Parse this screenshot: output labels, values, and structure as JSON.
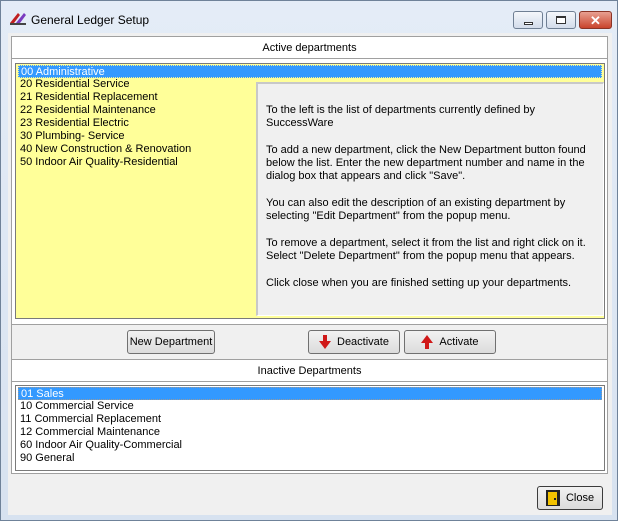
{
  "window": {
    "title": "General Ledger Setup",
    "controls": {
      "minimize": "minimize",
      "maximize": "maximize",
      "close": "✕"
    }
  },
  "active_section": {
    "header": "Active departments",
    "items": [
      {
        "label": "00 Administrative",
        "selected": true
      },
      {
        "label": "20 Residential Service",
        "selected": false
      },
      {
        "label": "21 Residential Replacement",
        "selected": false
      },
      {
        "label": "22 Residential Maintenance",
        "selected": false
      },
      {
        "label": "23 Residential Electric",
        "selected": false
      },
      {
        "label": "30 Plumbing- Service",
        "selected": false
      },
      {
        "label": "40 New Construction & Renovation",
        "selected": false
      },
      {
        "label": "50 Indoor Air Quality-Residential",
        "selected": false
      }
    ]
  },
  "info": {
    "p1": "To the left is the list of departments currently defined by SuccessWare",
    "p2": "To add a new department, click the New Department button found below the list. Enter the new department number and name in the dialog box that appears and click \"Save\".",
    "p3": "You can also edit the description of an existing department by selecting \"Edit Department\" from the popup menu.",
    "p4": "To remove a department, select it from the list and right click on it. Select \"Delete Department\" from the popup menu that appears.",
    "p5": "Click close when you are finished setting up your departments."
  },
  "buttons": {
    "new_department": "New Department",
    "deactivate": "Deactivate",
    "activate": "Activate",
    "close": "Close"
  },
  "inactive_section": {
    "header": "Inactive Departments",
    "items": [
      {
        "label": "01 Sales",
        "selected": true
      },
      {
        "label": "10 Commercial Service",
        "selected": false
      },
      {
        "label": "11 Commercial Replacement",
        "selected": false
      },
      {
        "label": "12 Commercial Maintenance",
        "selected": false
      },
      {
        "label": "60 Indoor Air Quality-Commercial",
        "selected": false
      },
      {
        "label": "90 General",
        "selected": false
      }
    ]
  },
  "colors": {
    "selection": "#3399ff",
    "active_list_bg": "#ffff99",
    "arrow_red": "#d01818"
  }
}
